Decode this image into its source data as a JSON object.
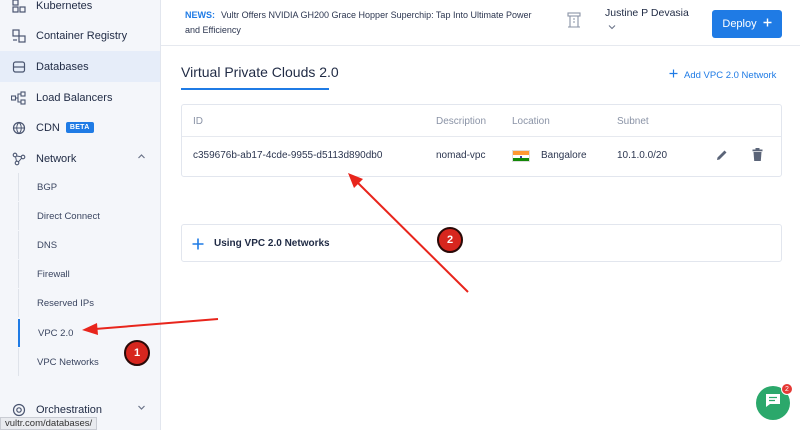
{
  "sidebar": {
    "items": [
      {
        "label": "Kubernetes",
        "icon": "kubernetes-icon"
      },
      {
        "label": "Container Registry",
        "icon": "registry-icon"
      },
      {
        "label": "Databases",
        "icon": "database-icon"
      },
      {
        "label": "Load Balancers",
        "icon": "load-balancer-icon"
      },
      {
        "label": "CDN",
        "icon": "cdn-icon",
        "badge": "BETA"
      },
      {
        "label": "Network",
        "icon": "network-icon"
      },
      {
        "label": "Orchestration",
        "icon": "orchestration-icon"
      }
    ],
    "network_subitems": [
      "BGP",
      "Direct Connect",
      "DNS",
      "Firewall",
      "Reserved IPs",
      "VPC 2.0",
      "VPC Networks"
    ],
    "status_url": "vultr.com/databases/"
  },
  "header": {
    "news_tag": "NEWS:",
    "news_text": "Vultr Offers NVIDIA GH200 Grace Hopper Superchip: Tap Into Ultimate Power and Efficiency",
    "user_name": "Justine P Devasia",
    "deploy_label": "Deploy"
  },
  "main": {
    "title": "Virtual Private Clouds 2.0",
    "add_link": "Add VPC 2.0 Network",
    "table": {
      "columns": [
        "ID",
        "Description",
        "Location",
        "Subnet"
      ],
      "rows": [
        {
          "id": "c359676b-ab17-4cde-9955-d5113d890db0",
          "description": "nomad-vpc",
          "location": "Bangalore",
          "subnet": "10.1.0.0/20"
        }
      ]
    },
    "info_label": "Using VPC 2.0 Networks"
  },
  "annotations": {
    "step1": "1",
    "step2": "2"
  },
  "chat": {
    "count": "2"
  },
  "colors": {
    "accent": "#1f7be5",
    "annotation": "#d7261e",
    "chat": "#2ba86b"
  }
}
